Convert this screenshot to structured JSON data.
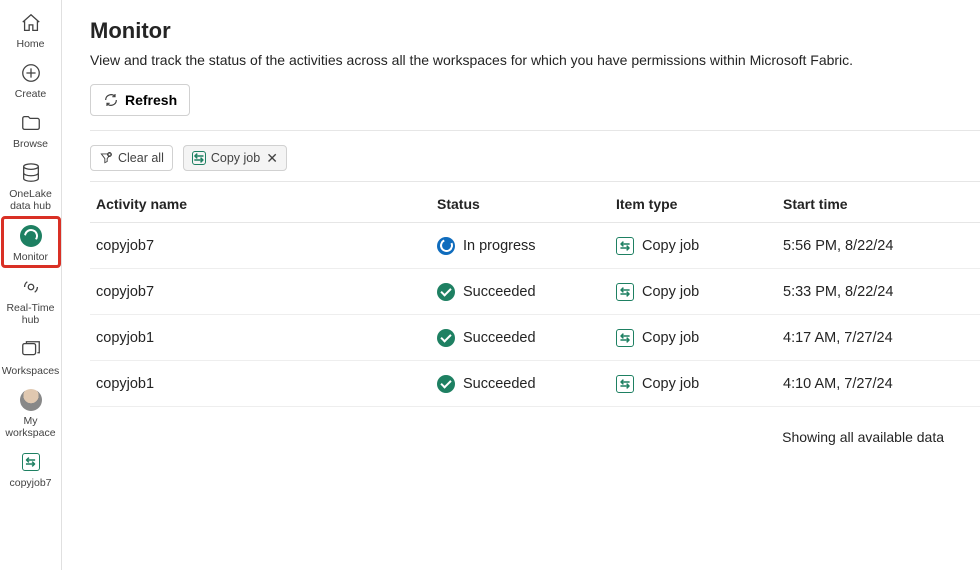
{
  "sidebar": {
    "items": [
      {
        "label": "Home"
      },
      {
        "label": "Create"
      },
      {
        "label": "Browse"
      },
      {
        "label": "OneLake data hub"
      },
      {
        "label": "Monitor"
      },
      {
        "label": "Real-Time hub"
      },
      {
        "label": "Workspaces"
      },
      {
        "label": "My workspace"
      },
      {
        "label": "copyjob7"
      }
    ]
  },
  "page": {
    "title": "Monitor",
    "subtitle": "View and track the status of the activities across all the workspaces for which you have permissions within Microsoft Fabric."
  },
  "toolbar": {
    "refresh_label": "Refresh"
  },
  "chips": {
    "clear_all": "Clear all",
    "filter_label": "Copy job"
  },
  "table": {
    "headers": {
      "name": "Activity name",
      "status": "Status",
      "type": "Item type",
      "time": "Start time"
    },
    "rows": [
      {
        "name": "copyjob7",
        "status": "In progress",
        "status_kind": "progress",
        "type": "Copy job",
        "time": "5:56 PM, 8/22/24"
      },
      {
        "name": "copyjob7",
        "status": "Succeeded",
        "status_kind": "success",
        "type": "Copy job",
        "time": "5:33 PM, 8/22/24"
      },
      {
        "name": "copyjob1",
        "status": "Succeeded",
        "status_kind": "success",
        "type": "Copy job",
        "time": "4:17 AM, 7/27/24"
      },
      {
        "name": "copyjob1",
        "status": "Succeeded",
        "status_kind": "success",
        "type": "Copy job",
        "time": "4:10 AM, 7/27/24"
      }
    ],
    "footer": "Showing all available data"
  }
}
